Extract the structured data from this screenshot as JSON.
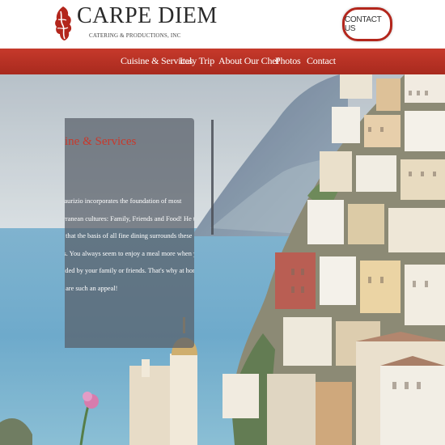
{
  "header": {
    "logo_title": "CARPE DIEM",
    "logo_subtitle": "CATERING & PRODUCTIONS, INC",
    "contact_button": "CONTACT US"
  },
  "nav": {
    "items": [
      {
        "label": "Cuisine & Services"
      },
      {
        "label": "Italy Trip"
      },
      {
        "label": "About Our Chef"
      },
      {
        "label": "Photos"
      },
      {
        "label": "Contact"
      }
    ]
  },
  "card": {
    "title": "isine & Services",
    "lines": [
      "Maurizio incorporates the foundation of most",
      "terranean cultures: Family, Friends and Food! He truly",
      "es that the basis of all fine dining surrounds these",
      "ms. You always seem to enjoy a meal more when you are",
      "unded by your family or friends. That's why at home",
      "es are such an appeal!"
    ]
  },
  "colors": {
    "brand_red": "#b3261c",
    "nav_red": "#c6392b",
    "card_bg": "#585e68",
    "sea": "#5b9fc4"
  }
}
